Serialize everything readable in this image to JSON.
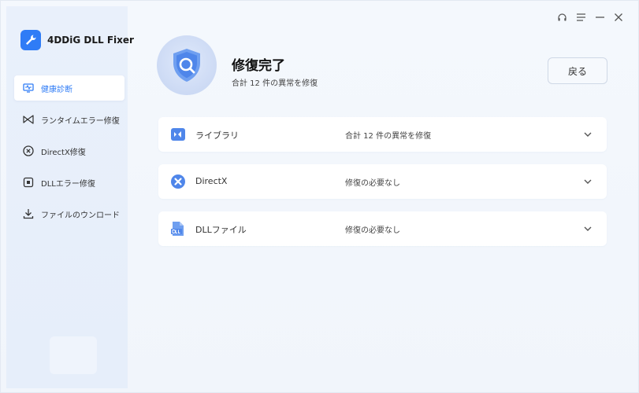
{
  "app": {
    "name": "4DDiG DLL Fixer",
    "accent_color": "#2f7cf6"
  },
  "sidebar": {
    "items": [
      {
        "label": "健康診断",
        "icon": "monitor-pulse-icon",
        "active": true
      },
      {
        "label": "ランタイムエラー修復",
        "icon": "vs-bowtie-icon",
        "active": false
      },
      {
        "label": "DirectX修復",
        "icon": "x-circle-icon",
        "active": false
      },
      {
        "label": "DLLエラー修復",
        "icon": "square-dot-icon",
        "active": false
      },
      {
        "label": "ファイルのウンロード",
        "icon": "download-icon",
        "active": false
      }
    ]
  },
  "titlebar": {
    "icons": [
      "headset-icon",
      "menu-icon",
      "minimize-icon",
      "close-icon"
    ]
  },
  "header": {
    "title": "修復完了",
    "subtitle": "合計 12 件の異常を修復",
    "back_label": "戻る"
  },
  "results": [
    {
      "name": "ライブラリ",
      "status": "合計 12 件の異常を修復",
      "icon": "visual-studio-icon"
    },
    {
      "name": "DirectX",
      "status": "修復の必要なし",
      "icon": "directx-icon"
    },
    {
      "name": "DLLファイル",
      "status": "修復の必要なし",
      "icon": "dll-file-icon"
    }
  ]
}
